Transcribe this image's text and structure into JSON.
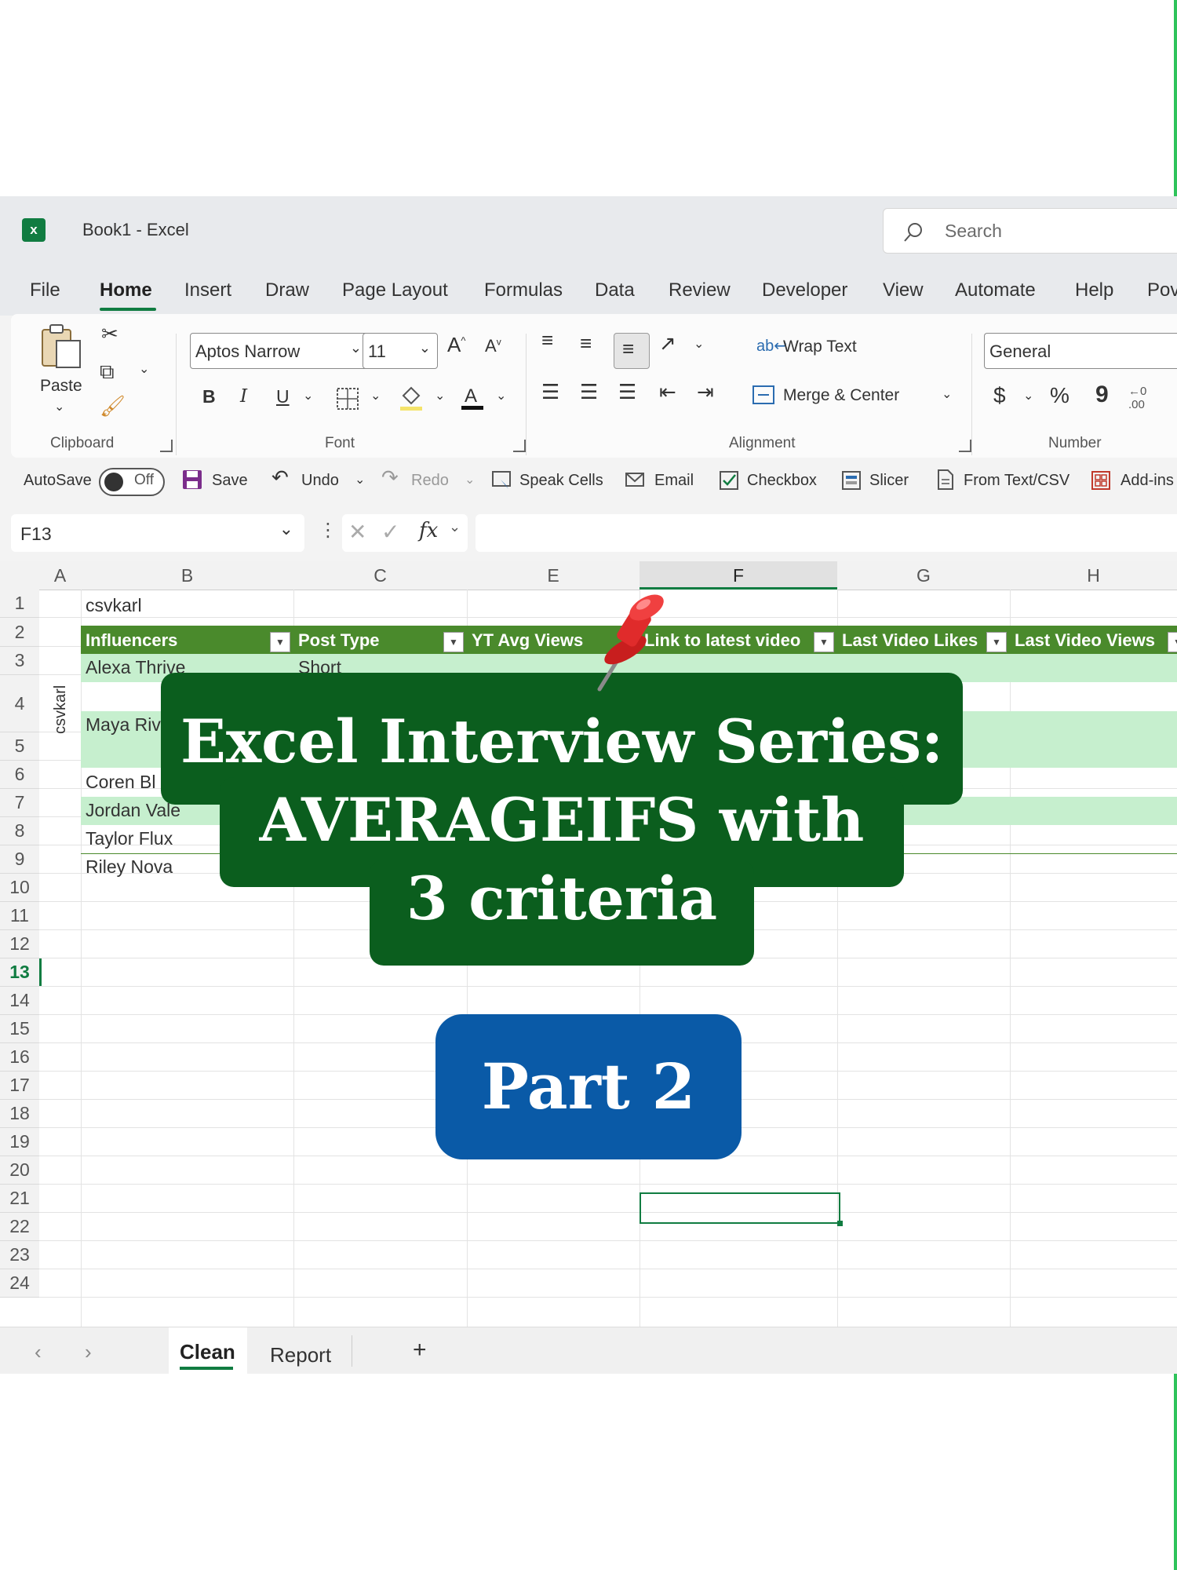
{
  "window": {
    "title": "Book1  -  Excel",
    "search_placeholder": "Search"
  },
  "menu": [
    "File",
    "Home",
    "Insert",
    "Draw",
    "Page Layout",
    "Formulas",
    "Data",
    "Review",
    "Developer",
    "View",
    "Automate",
    "Help",
    "Pov"
  ],
  "ribbon": {
    "clipboard": {
      "paste": "Paste",
      "label": "Clipboard"
    },
    "font": {
      "family": "Aptos Narrow",
      "size": "11",
      "label": "Font",
      "bold": "B",
      "italic": "I",
      "underline": "U"
    },
    "alignment": {
      "wrap_text": "Wrap Text",
      "merge_center": "Merge & Center",
      "label": "Alignment"
    },
    "number": {
      "format": "General",
      "label": "Number",
      "currency": "$",
      "percent": "%",
      "comma": "9"
    }
  },
  "qat": {
    "autosave": "AutoSave",
    "toggle": "Off",
    "save": "Save",
    "undo": "Undo",
    "redo": "Redo",
    "speak_cells": "Speak Cells",
    "email": "Email",
    "checkbox": "Checkbox",
    "slicer": "Slicer",
    "from_text": "From Text/CSV",
    "addins": "Add-ins"
  },
  "formula_bar": {
    "name_box": "F13",
    "fx": "fx",
    "value": ""
  },
  "sheet": {
    "columns": [
      "A",
      "B",
      "C",
      "E",
      "F",
      "G",
      "H"
    ],
    "rows": [
      "1",
      "2",
      "3",
      "4",
      "5",
      "6",
      "7",
      "8",
      "9",
      "10",
      "11",
      "12",
      "13",
      "14",
      "15",
      "16",
      "17",
      "18",
      "19",
      "20",
      "21",
      "22",
      "23",
      "24"
    ],
    "b1": "csvkarl",
    "side_label": "csvkarl",
    "headers": [
      "Influencers",
      "Post Type",
      "YT Avg Views",
      "Link to latest video",
      "Last Video Likes",
      "Last Video Views"
    ],
    "names": [
      "Alexa Thrive",
      "Maya Riv",
      "Coren Bl",
      "Jordan Vale",
      "Taylor Flux",
      "Riley Nova"
    ],
    "c3": "Short"
  },
  "sheet_tabs": [
    "Clean",
    "Report"
  ],
  "add_sheet": "+",
  "overlay": {
    "title_lines": [
      "Excel Interview Series:",
      "AVERAGEIFS with",
      "3 criteria"
    ],
    "badge": "Part 2"
  }
}
